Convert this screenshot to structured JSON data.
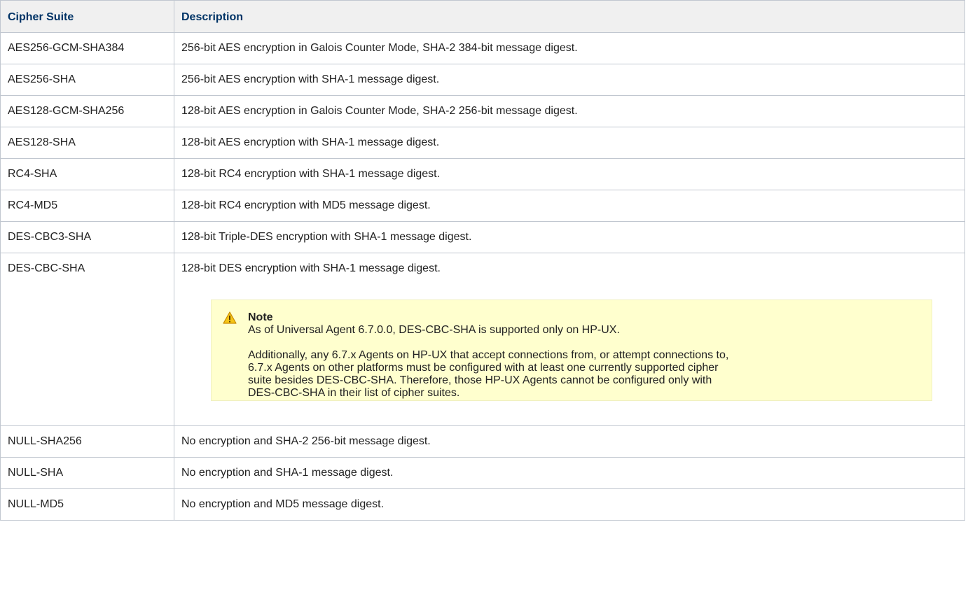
{
  "table": {
    "headers": [
      "Cipher Suite",
      "Description"
    ],
    "rows": [
      {
        "suite": "AES256-GCM-SHA384",
        "description": "256-bit AES encryption in Galois Counter Mode, SHA-2 384-bit message digest."
      },
      {
        "suite": "AES256-SHA",
        "description": "256-bit AES encryption with SHA-1 message digest."
      },
      {
        "suite": "AES128-GCM-SHA256",
        "description": "128-bit AES encryption in Galois Counter Mode, SHA-2 256-bit message digest."
      },
      {
        "suite": "AES128-SHA",
        "description": "128-bit AES encryption with SHA-1 message digest."
      },
      {
        "suite": "RC4-SHA",
        "description": "128-bit RC4 encryption with SHA-1 message digest."
      },
      {
        "suite": "RC4-MD5",
        "description": "128-bit RC4 encryption with MD5 message digest."
      },
      {
        "suite": "DES-CBC3-SHA",
        "description": "128-bit Triple-DES encryption with SHA-1 message digest."
      },
      {
        "suite": "DES-CBC-SHA",
        "description": "128-bit DES encryption with SHA-1 message digest."
      },
      {
        "suite": "NULL-SHA256",
        "description": "No encryption and SHA-2 256-bit message digest."
      },
      {
        "suite": "NULL-SHA",
        "description": "No encryption and SHA-1 message digest."
      },
      {
        "suite": "NULL-MD5",
        "description": "No encryption and MD5 message digest."
      }
    ]
  },
  "note": {
    "icon": "warning-icon",
    "title": "Note",
    "line1": "As of Universal Agent 6.7.0.0, DES-CBC-SHA is supported only on HP-UX.",
    "para2_lines": [
      "Additionally, any 6.7.x Agents on HP-UX that accept connections from, or attempt connections to,",
      "6.7.x Agents on other platforms must be configured with at least one currently supported cipher",
      "suite besides DES-CBC-SHA. Therefore, those HP-UX Agents cannot be configured only with",
      "DES-CBC-SHA in their list of cipher suites."
    ]
  },
  "colors": {
    "header_text": "#003366",
    "header_bg": "#f0f0f0",
    "border": "#c1c7d0",
    "note_bg": "#ffffce",
    "warning_icon": "#e8a317"
  }
}
